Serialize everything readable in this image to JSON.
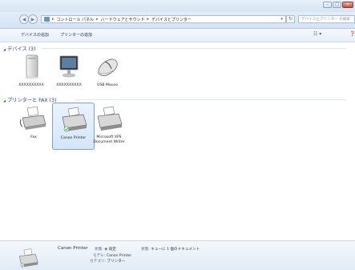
{
  "window": {
    "controls": [
      "–",
      "□",
      "✕"
    ]
  },
  "address_bar": {
    "crumbs": [
      "コントロール パネル",
      "ハードウェアとサウンド",
      "デバイスとプリンター"
    ],
    "search_placeholder": "デバイスとプリンター の検索"
  },
  "command_bar": {
    "add_device": "デバイスの追加",
    "add_printer": "プリンターの追加"
  },
  "groups": {
    "devices": {
      "header": "デバイス (3)",
      "items": [
        {
          "label": "XXXXXXXXXX",
          "icon": "computer-tower-icon"
        },
        {
          "label": "XXXXXXXXXX",
          "icon": "monitor-icon"
        },
        {
          "label": "USB Mouse",
          "icon": "mouse-icon"
        }
      ]
    },
    "printers": {
      "header": "プリンターと FAX (3)",
      "items": [
        {
          "label": "Fax",
          "icon": "fax-icon"
        },
        {
          "label": "Canon Printer",
          "icon": "printer-icon",
          "selected": true
        },
        {
          "label": "Microsoft XPS Document Writer",
          "icon": "printer-icon"
        }
      ]
    }
  },
  "details": {
    "name": "Canon Printer",
    "state_label": "状態:",
    "state_value": "既定",
    "model_label": "モデル:",
    "model_value": "Canon Printer",
    "category_label": "カテゴリ:",
    "category_value": "プリンター",
    "queue_label": "状態:",
    "queue_value": "キューに 1 個のドキュメント"
  },
  "colors": {
    "selection": "#d4e6fa",
    "group_header": "#1e3d8f"
  }
}
